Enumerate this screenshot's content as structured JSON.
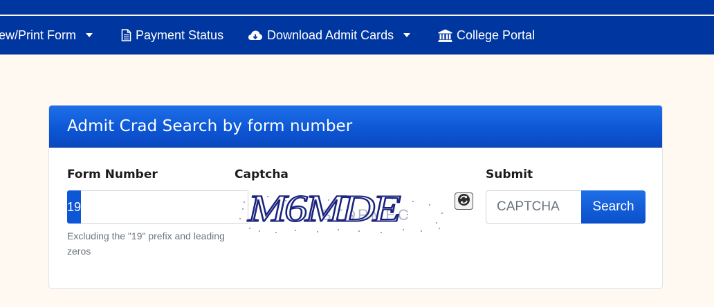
{
  "navbar": {
    "items": [
      {
        "label": "ew/Print Form",
        "icon": "none",
        "dropdown": true
      },
      {
        "label": "Payment Status",
        "icon": "document-icon",
        "dropdown": false
      },
      {
        "label": "Download Admit Cards",
        "icon": "cloud-download-icon",
        "dropdown": true
      },
      {
        "label": "College Portal",
        "icon": "university-icon",
        "dropdown": false
      }
    ]
  },
  "card": {
    "title": "Admit Crad Search by form number",
    "form_number": {
      "label": "Form Number",
      "prefix": "19",
      "value": "",
      "help": "Excluding the \"19\" prefix and leading zeros"
    },
    "captcha": {
      "label": "Captcha",
      "text": "M6MDE"
    },
    "submit": {
      "label": "Submit",
      "placeholder": "CAPTCHA",
      "button": "Search"
    }
  },
  "colors": {
    "nav_bg": "#0036a0",
    "header_blue": "#0d57d6",
    "page_bg": "#fff9f1"
  }
}
